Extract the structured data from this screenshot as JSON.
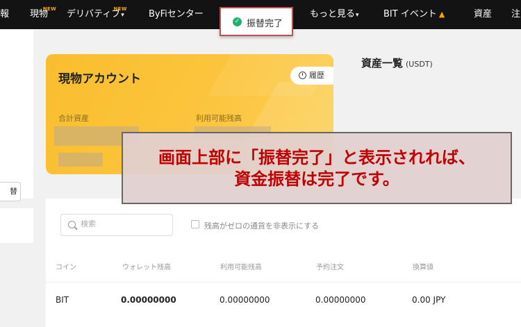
{
  "nav": {
    "items": [
      {
        "label": "報",
        "x": 0
      },
      {
        "label": "現物",
        "new": "NEW"
      },
      {
        "label": "デリバティブ",
        "new": "NEW",
        "caret": "▾"
      },
      {
        "label": "ByFiセンター"
      },
      {
        "label": "もっと見る",
        "caret": "▾"
      },
      {
        "label": "BIT イベント",
        "icon": "flame-icon"
      },
      {
        "label": "資産"
      },
      {
        "label": "注"
      }
    ]
  },
  "toast": {
    "message": "振替完了",
    "status": "success",
    "icon": "check-circle-icon",
    "border_color": "#c0504d"
  },
  "sidebar": {
    "button_label": "替"
  },
  "card": {
    "title": "現物アカウント",
    "history_label": "履歴",
    "labels": [
      "合計資産",
      "利用可能残高"
    ],
    "background": "#fcc53e"
  },
  "assets": {
    "title": "資産一覧",
    "unit": "(USDT)"
  },
  "search": {
    "placeholder": "検索",
    "value": ""
  },
  "hide_zero_label": "残高がゼロの通貨を非表示にする",
  "table": {
    "columns": [
      "コイン",
      "ウォレット残高",
      "利用可能残高",
      "予約注文",
      "換算値"
    ],
    "rows": [
      {
        "coin": "BIT",
        "wallet": "0.00000000",
        "available": "0.00000000",
        "reserved": "0.00000000",
        "value": "0.00 JPY"
      }
    ]
  },
  "annotation": {
    "line1": "画面上部に「振替完了」と表示されれば、",
    "line2": "資金振替は完了です。",
    "text_color": "#c00000"
  }
}
